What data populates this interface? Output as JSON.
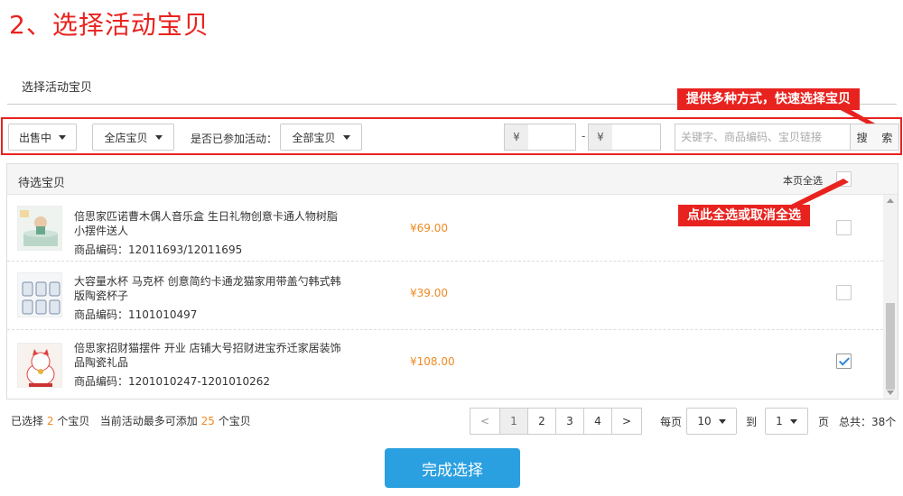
{
  "page": {
    "heading": "2、选择活动宝贝",
    "subtitle": "选择活动宝贝"
  },
  "annotations": {
    "top": "提供多种方式，快速选择宝贝",
    "middle": "点此全选或取消全选",
    "color": "#e8231f"
  },
  "filters": {
    "status": "出售中",
    "scope": "全店宝贝",
    "joined_label": "是否已参加活动：",
    "joined_value": "全部宝贝",
    "currency_symbol": "¥",
    "price_separator": "-",
    "price_min": "",
    "price_max": "",
    "search_placeholder": "关键字、商品编码、宝贝链接",
    "search_button": "搜 索"
  },
  "panel": {
    "title": "待选宝贝",
    "select_all_label": "本页全选",
    "select_all_checked": false
  },
  "products": [
    {
      "name": "倍思家匹诺曹木偶人音乐盒 生日礼物创意卡通人物树脂小摆件送人",
      "code_label": "商品编码：",
      "code": "12011693/12011695",
      "price": "¥69.00",
      "checked": false,
      "thumb_icon": "music-box-thumbnail"
    },
    {
      "name": "大容量水杯 马克杯 创意简约卡通龙猫家用带盖勺韩式韩版陶瓷杯子",
      "code_label": "商品编码：",
      "code": "1101010497",
      "price": "¥39.00",
      "checked": false,
      "thumb_icon": "mug-set-thumbnail"
    },
    {
      "name": "倍思家招财猫摆件 开业 店铺大号招财进宝乔迁家居装饰品陶瓷礼品",
      "code_label": "商品编码：",
      "code": "1201010247-1201010262",
      "price": "¥108.00",
      "checked": true,
      "thumb_icon": "lucky-cat-thumbnail"
    }
  ],
  "footer": {
    "selected_prefix": "已选择",
    "selected_count": "2",
    "selected_unit": "个宝贝",
    "max_prefix": "当前活动最多可添加",
    "max_count": "25",
    "max_unit": "个宝贝",
    "pages": [
      "<",
      "1",
      "2",
      "3",
      "4",
      ">"
    ],
    "active_page": "1",
    "per_page_label": "每页",
    "per_page_value": "10",
    "goto_label": "到",
    "goto_value": "1",
    "page_unit": "页",
    "total": "总共：38个",
    "done_button": "完成选择"
  },
  "colors": {
    "accent_red": "#e8231f",
    "price_orange": "#f08a24",
    "primary_blue": "#2aa0e0",
    "check_blue": "#2b87d8"
  }
}
